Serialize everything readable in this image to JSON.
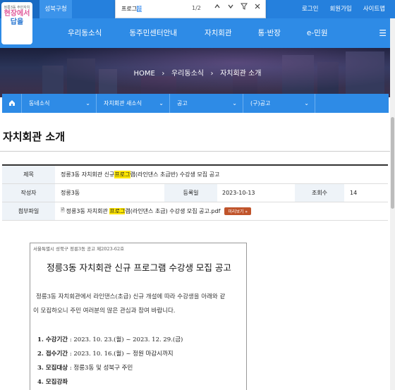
{
  "topbar": {
    "home": "홈으로",
    "seongbuk": "성북구청",
    "login": "로그인",
    "signup": "회원가입",
    "sitemap": "사이트맵"
  },
  "findbar": {
    "query_plain": "프로그",
    "query_selected": "램",
    "count": "1/2"
  },
  "logo": {
    "small": "정릉3동 주민자치",
    "line1": "현장에서",
    "line2": "답을"
  },
  "mainnav": {
    "items": [
      "우리동소식",
      "동주민센터안내",
      "자치회관",
      "통·반장",
      "e-민원"
    ]
  },
  "hero": {
    "breadcrumb_home": "HOME",
    "breadcrumb_1": "우리동소식",
    "breadcrumb_2": "자치회관 소개"
  },
  "subnav": {
    "items": [
      "동네소식",
      "자치회관 새소식",
      "공고",
      "(구)공고"
    ]
  },
  "page": {
    "title": "자치회관 소개"
  },
  "post": {
    "subject_label": "제목",
    "subject_pre": "정릉3동 자치회관 신규 ",
    "subject_hl": "프로그",
    "subject_mid": "램",
    "subject_post": "(라인댄스 초급반) 수강생 모집 공고",
    "author_label": "작성자",
    "author": "정릉3동",
    "date_label": "등록일",
    "date": "2023-10-13",
    "views_label": "조회수",
    "views": "14",
    "attach_label": "첨부파일",
    "attach_pre": "정릉3동 자치회관 ",
    "attach_hl": "프로그",
    "attach_post": "램(라인댄스 초급) 수강생 모집 공고.pdf",
    "preview": "미리보기"
  },
  "document": {
    "header": "서울특별시 성북구 정릉3동 공고 제2023-62호",
    "title": "정릉3동 자치회관 신규 프로그램 수강생 모집 공고",
    "para1": "정릉3동 자치회관에서 라인댄스(초급) 신규 개설에 따라 수강생을 아래와 같",
    "para2": "이 모집하오니 주민 여러분의 많은 관심과 참여 바랍니다.",
    "item1_label": "1. 수강기간",
    "item1_value": " : 2023. 10. 23.(월) ~ 2023. 12. 29.(금)",
    "item2_label": "2. 접수기간",
    "item2_value": " : 2023. 10. 16.(월) ~ 정원 마감시까지",
    "item3_label": "3. 모집대상",
    "item3_value": " : 정릉3동 및 성북구 주민",
    "item4_label": "4. 모집강좌",
    "item4_value": ""
  }
}
